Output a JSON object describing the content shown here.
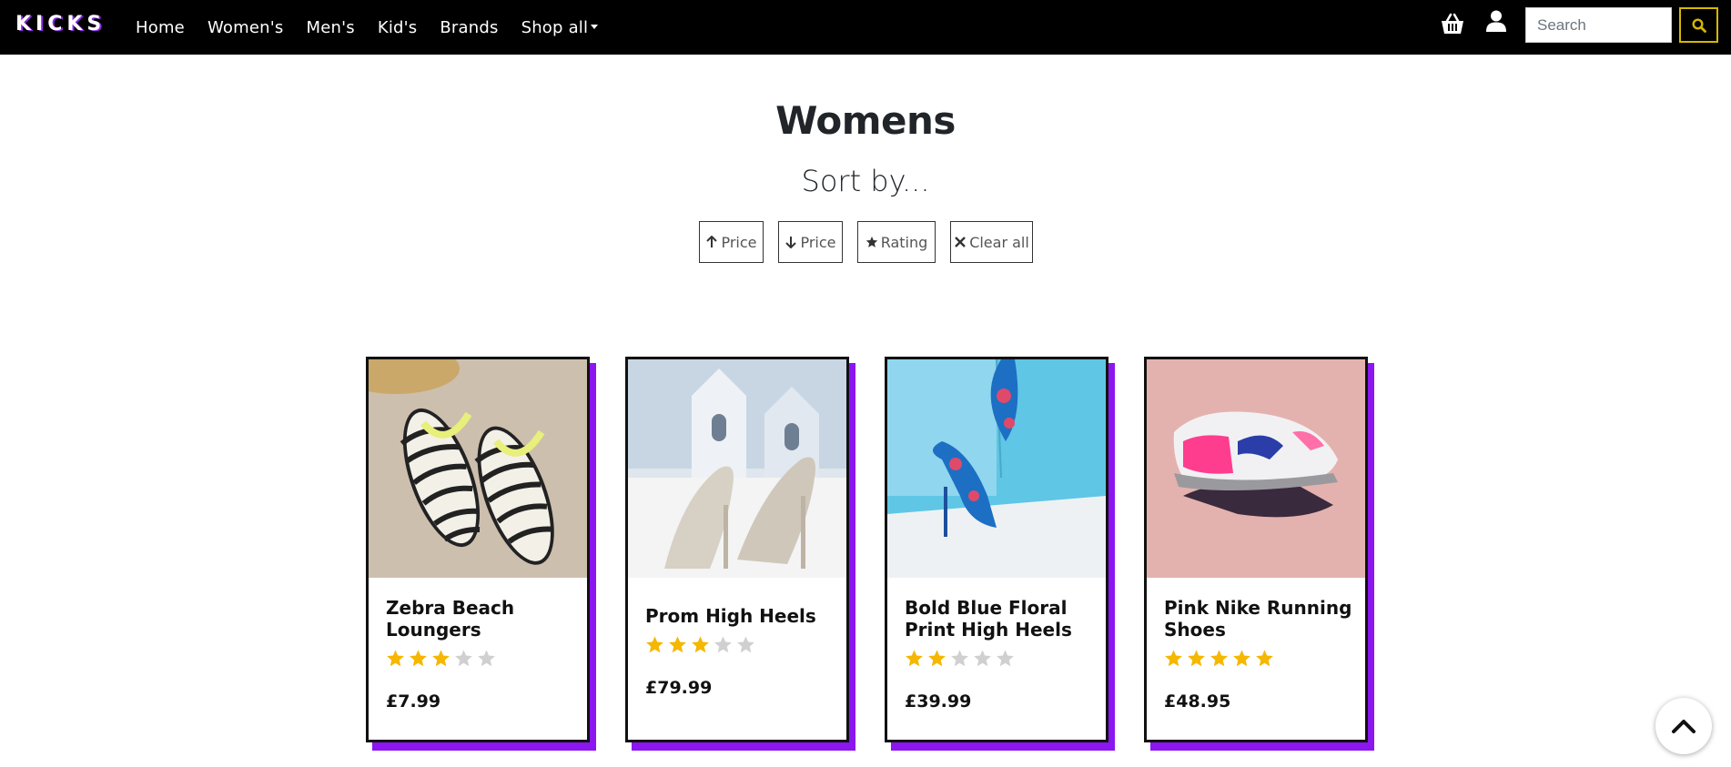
{
  "nav": {
    "logo": "KICKS",
    "links": [
      {
        "label": "Home"
      },
      {
        "label": "Women's"
      },
      {
        "label": "Men's"
      },
      {
        "label": "Kid's"
      },
      {
        "label": "Brands"
      },
      {
        "label": "Shop all"
      }
    ],
    "search_placeholder": "Search",
    "icons": [
      "basket-icon",
      "user-icon",
      "search-icon"
    ],
    "accent_color": "#d4b800"
  },
  "page": {
    "title": "Womens",
    "sort_label": "Sort by...",
    "sort_buttons": [
      {
        "label": "Price",
        "icon": "arrow-up-icon"
      },
      {
        "label": "Price",
        "icon": "arrow-down-icon"
      },
      {
        "label": "Rating",
        "icon": "star-icon"
      },
      {
        "label": "Clear all",
        "icon": "x-icon"
      }
    ]
  },
  "products": [
    {
      "name": "Zebra Beach Loungers",
      "rating": 3,
      "max_rating": 5,
      "price": "£7.99"
    },
    {
      "name": "Prom High Heels",
      "rating": 3,
      "max_rating": 5,
      "price": "£79.99"
    },
    {
      "name": "Bold Blue Floral Print High Heels",
      "rating": 2,
      "max_rating": 5,
      "price": "£39.99"
    },
    {
      "name": "Pink Nike Running Shoes",
      "rating": 5,
      "max_rating": 5,
      "price": "£48.95"
    }
  ],
  "colors": {
    "card_shadow": "#8b16f0",
    "star_filled": "#f5b700",
    "star_empty": "#d0d0d0"
  }
}
